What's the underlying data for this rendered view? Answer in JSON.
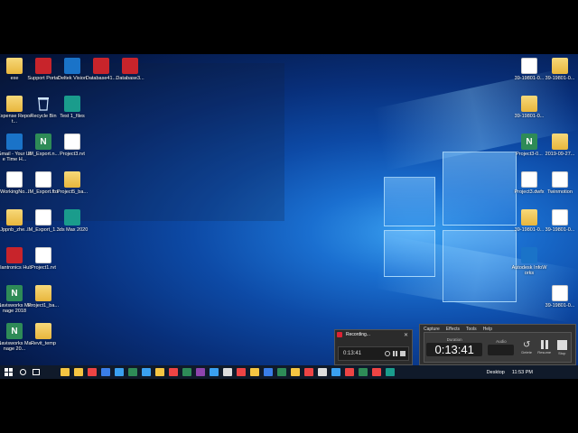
{
  "desktop_icons": [
    {
      "label": "exe",
      "kind": "folder"
    },
    {
      "label": "Support Portal",
      "kind": "red"
    },
    {
      "label": "Deltek Vision",
      "kind": "pdf"
    },
    {
      "label": "Database41...",
      "kind": "red"
    },
    {
      "label": "Database3...",
      "kind": "red"
    },
    {
      "label": "Expense Report...",
      "kind": "folder"
    },
    {
      "label": "Recycle Bin",
      "kind": "recbin"
    },
    {
      "label": "Test 1_files",
      "kind": "teal"
    },
    {
      "label": "Gmail - Your Life Time H...",
      "kind": "pdf"
    },
    {
      "label": "IM_Export.n...",
      "kind": "nav"
    },
    {
      "label": "Project3.rvt",
      "kind": "doc"
    },
    {
      "label": "WorkingNo...",
      "kind": "doc"
    },
    {
      "label": "IM_Export.fbx",
      "kind": "doc"
    },
    {
      "label": "Project5_ba...",
      "kind": "folder"
    },
    {
      "label": "Jppnb_zhe...",
      "kind": "folder"
    },
    {
      "label": "IM_Export_1...",
      "kind": "doc"
    },
    {
      "label": "3ds Max 2020",
      "kind": "teal"
    },
    {
      "label": "Plantronics Hub",
      "kind": "red"
    },
    {
      "label": "Project1.rvt",
      "kind": "doc"
    },
    {
      "label": "Navisworks Manage 2018",
      "kind": "nav"
    },
    {
      "label": "Project1_ba...",
      "kind": "folder"
    },
    {
      "label": "Navisworks Manage 20...",
      "kind": "nav"
    },
    {
      "label": "Revit_temp",
      "kind": "folder"
    }
  ],
  "right_icons": [
    {
      "label": "39-19801-0...",
      "kind": "doc"
    },
    {
      "label": "39-19801-0...",
      "kind": "folder"
    },
    {
      "label": "39-19801-0...",
      "kind": "folder"
    },
    {
      "label": "Project3-0...",
      "kind": "nav"
    },
    {
      "label": "2019-09-27...",
      "kind": "folder"
    },
    {
      "label": "Project3.dwfx",
      "kind": "doc"
    },
    {
      "label": "Twinmotion",
      "kind": "doc"
    },
    {
      "label": "39-19801-0...",
      "kind": "folder"
    },
    {
      "label": "39-19801-0...",
      "kind": "doc"
    },
    {
      "label": "Autodesk InfoWorks",
      "kind": "pdf"
    },
    {
      "label": "39-19801-0...",
      "kind": "doc"
    }
  ],
  "taskbar": {
    "desktop_label": "Desktop",
    "time": "11:53 PM"
  },
  "recording_small": {
    "title": "Recording...",
    "timer": "0:13:41"
  },
  "recording_main": {
    "menu": [
      "Capture",
      "Effects",
      "Tools",
      "Help"
    ],
    "duration_label": "Duration",
    "timer": "0:13:41",
    "audio_label": "Audio",
    "delete_label": "Delete",
    "resume_label": "Resume",
    "stop_label": "Stop"
  }
}
